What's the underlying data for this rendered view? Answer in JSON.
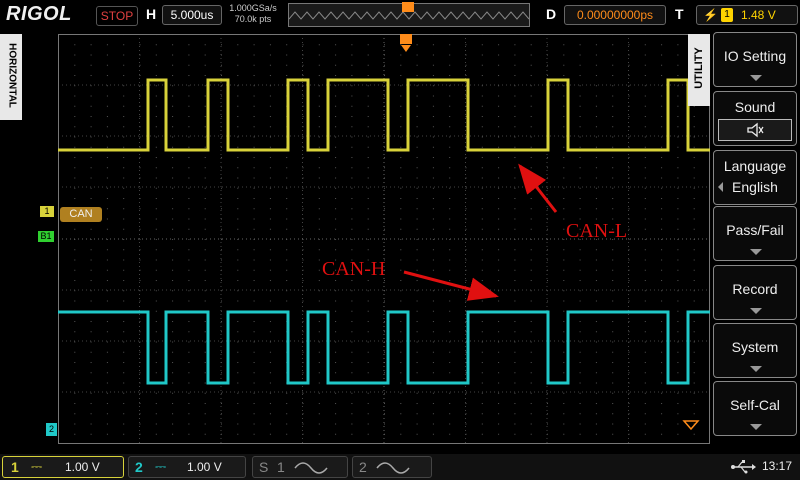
{
  "header": {
    "brand": "RIGOL",
    "run_state": "STOP",
    "horizontal_label": "H",
    "timebase": "5.000us",
    "sample_rate": "1.000GSa/s",
    "memory_depth": "70.0k pts",
    "delay_label": "D",
    "delay_value": "0.00000000ps",
    "trigger_label": "T",
    "trigger_channel": "1",
    "trigger_level": "1.48 V"
  },
  "left_tab": {
    "label": "HORIZONTAL"
  },
  "right_tab": {
    "label": "UTILITY"
  },
  "markers": {
    "ch1_marker": "1",
    "bus_marker": "B1",
    "bus_label": "CAN",
    "ch2_marker": "2"
  },
  "annotations": {
    "can_l": "CAN-L",
    "can_h": "CAN-H"
  },
  "menu": {
    "items": [
      {
        "label": "IO Setting"
      },
      {
        "label": "Sound",
        "value": "speaker-muted-icon"
      },
      {
        "label": "Language",
        "value": "English"
      },
      {
        "label": "Pass/Fail"
      },
      {
        "label": "Record"
      },
      {
        "label": "System"
      },
      {
        "label": "Self-Cal"
      }
    ]
  },
  "footer": {
    "ch1_num": "1",
    "ch1_scale": "1.00 V",
    "ch2_num": "2",
    "ch2_scale": "1.00 V",
    "s1_label": "S",
    "s1_num": "1",
    "s2_num": "2",
    "time": "13:17"
  },
  "colors": {
    "ch1": "#d8d23a",
    "ch2": "#20c8c8",
    "bus": "#b08020",
    "trigger": "#ff8c1a",
    "annotation": "#e01010"
  }
}
